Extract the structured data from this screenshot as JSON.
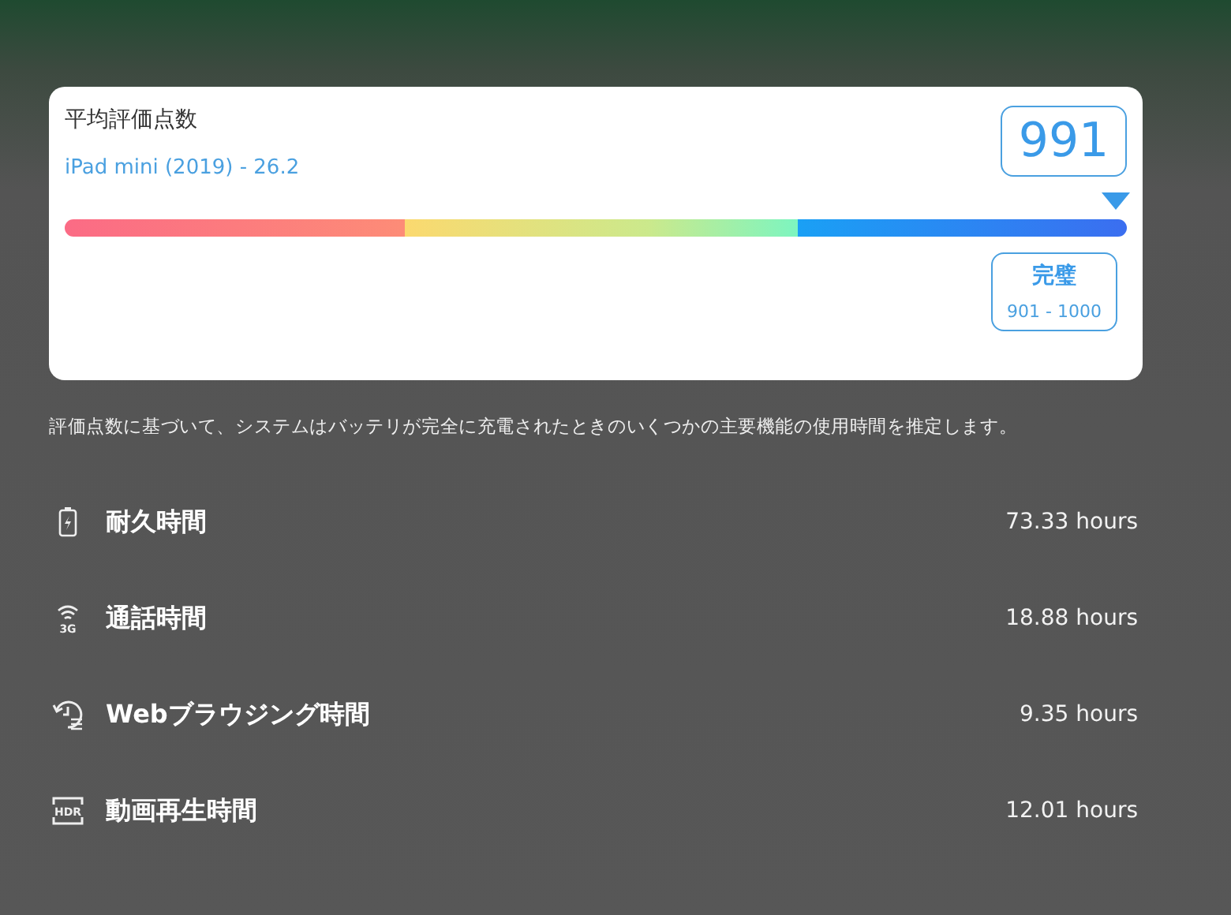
{
  "score_card": {
    "title": "平均評価点数",
    "device": "iPad mini (2019) - 26.2",
    "score": "991",
    "marker": {
      "level": 0.99
    },
    "rating": {
      "label": "完璧",
      "range": "901 - 1000"
    }
  },
  "description": "評価点数に基づいて、システムはバッテリが完全に充電されたときのいくつかの主要機能の使用時間を推定します。",
  "metrics": [
    {
      "kind": "battery",
      "label": "耐久時間",
      "value": "73.33 hours"
    },
    {
      "kind": "signal",
      "icon_text": "3G",
      "label": "通話時間",
      "value": "18.88 hours"
    },
    {
      "kind": "history",
      "label": "Webブラウジング時間",
      "value": "9.35 hours"
    },
    {
      "kind": "hdr",
      "icon_text": "HDR",
      "label": "動画再生時間",
      "value": "12.01 hours"
    }
  ]
}
